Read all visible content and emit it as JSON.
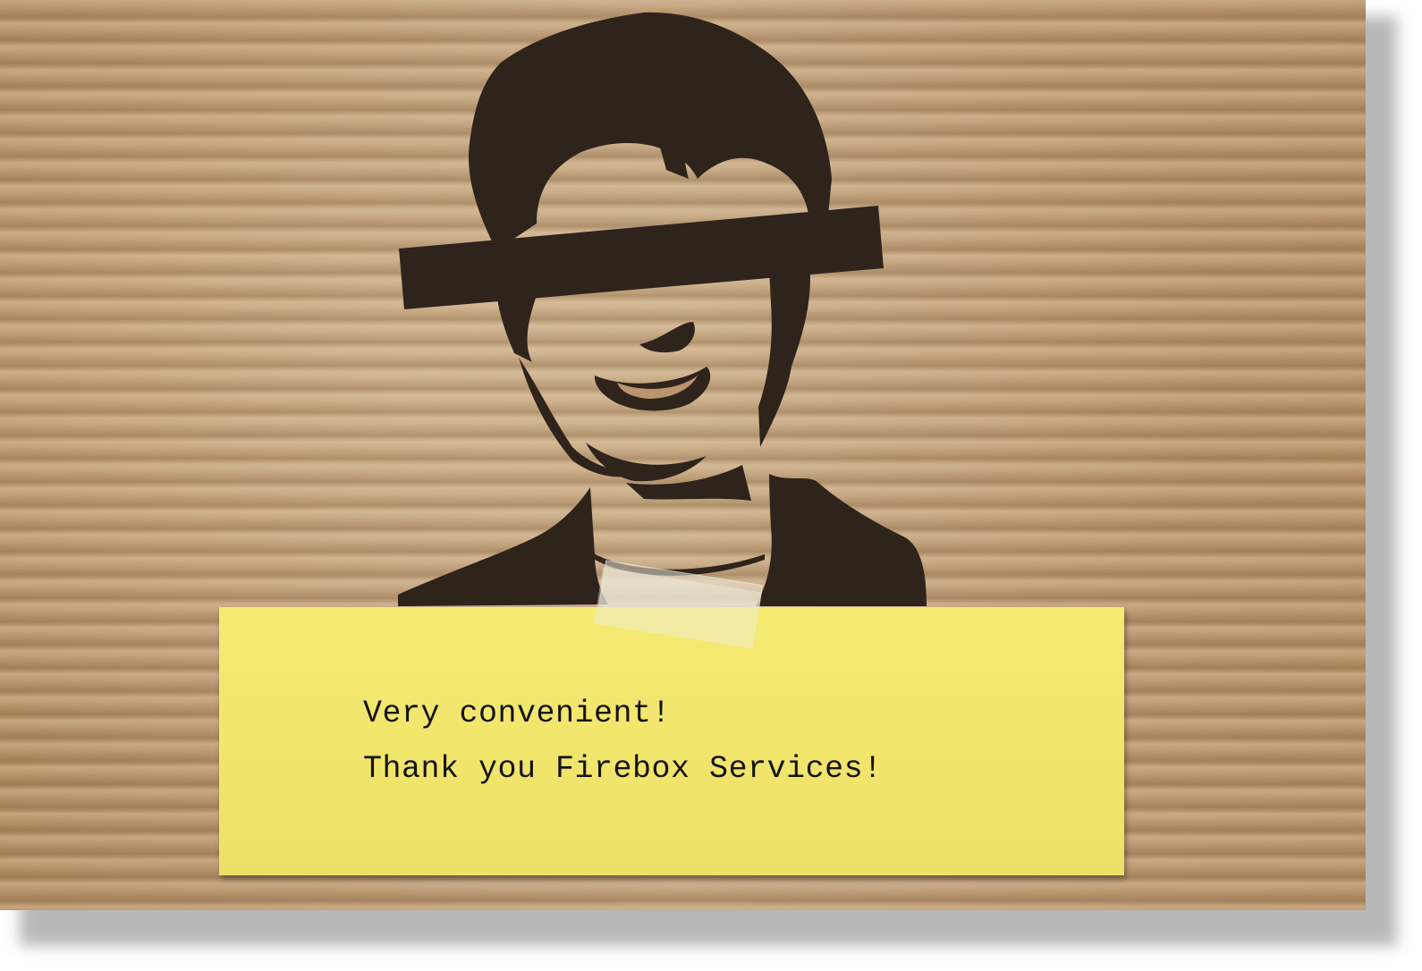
{
  "note": {
    "line1": "Very convenient!",
    "line2": "Thank you Firebox Services!"
  },
  "colors": {
    "cardboard": "#b9946c",
    "stencil_ink": "#2f241c",
    "sticky_note": "#f3e86f",
    "text": "#141414"
  },
  "icons": {
    "portrait": "stencil-portrait-with-censor-bar"
  }
}
